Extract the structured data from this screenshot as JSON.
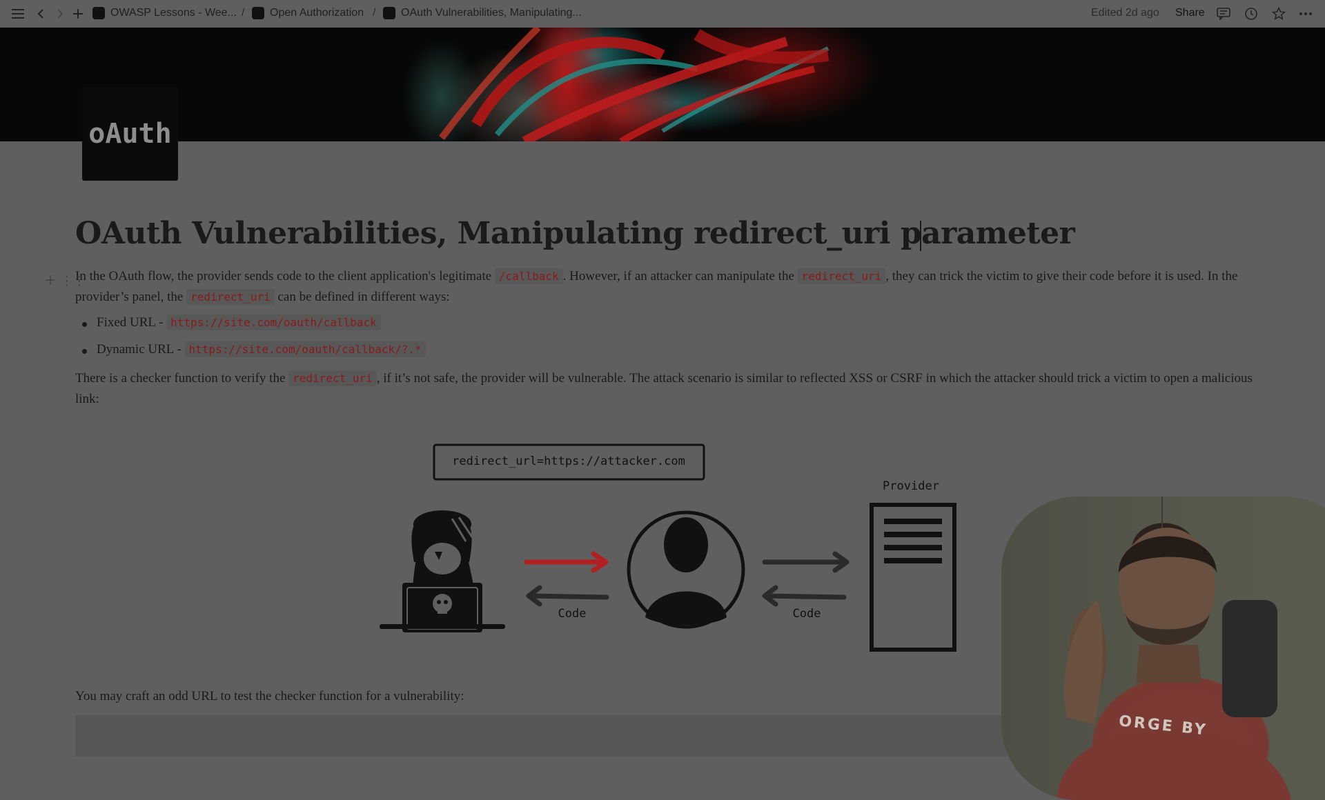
{
  "breadcrumbs": [
    {
      "label": "OWASP Lessons - Wee..."
    },
    {
      "label": "Open Authorization"
    },
    {
      "label": "OAuth Vulnerabilities, Manipulating..."
    }
  ],
  "header": {
    "edited": "Edited 2d ago",
    "share": "Share"
  },
  "page": {
    "logo_text": "oAuth",
    "title": "OAuth Vulnerabilities, Manipulating redirect_uri parameter",
    "p1": {
      "t1": "In the OAuth flow, the provider sends code to the client application's legitimate",
      "c1": "/callback",
      "t2": ". However, if an attacker can manipulate the",
      "c2": "redirect_uri",
      "t3": ", they can trick the victim to give their code before it is used. In the provider’s panel, the",
      "c3": "redirect_uri",
      "t4": "can be defined in different ways:"
    },
    "bullets": [
      {
        "label": "Fixed URL -",
        "code": "https://site.com/oauth/callback"
      },
      {
        "label": "Dynamic URL -",
        "code": "https://site.com/oauth/callback/?.*"
      }
    ],
    "p2": {
      "t1": "There is a checker function to verify the",
      "c1": "redirect_uri",
      "t2": ", if it’s not safe, the provider will be vulnerable. The attack scenario is similar to reflected XSS or CSRF in which the attacker should trick a victim to open a malicious link:"
    },
    "p3": "You may craft an odd URL to test the checker function for a vulnerability:"
  },
  "diagram": {
    "url_box": "redirect_url=https://attacker.com",
    "provider_label": "Provider",
    "code_label_1": "Code",
    "code_label_2": "Code",
    "arrow_red": "#b02020",
    "arrow_dark": "#2a2a2a"
  },
  "webcam": {
    "shirt_text": "ORGE BY"
  }
}
